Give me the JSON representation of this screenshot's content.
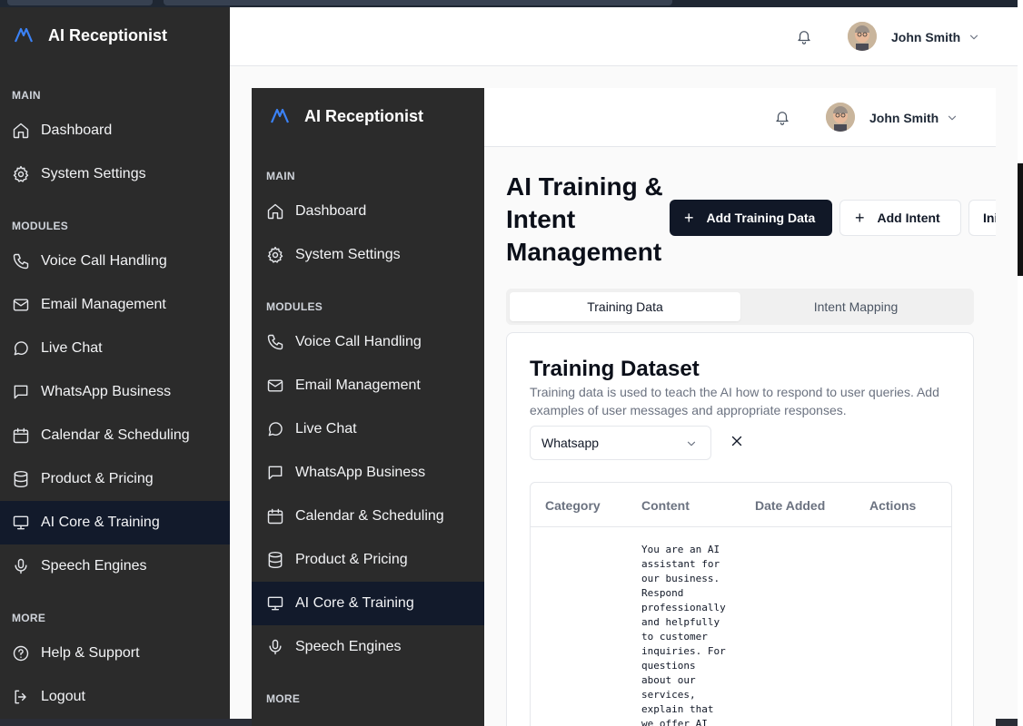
{
  "app": {
    "brand_name": "AI Receptionist"
  },
  "sidebar": {
    "sections": {
      "main": "MAIN",
      "modules": "MODULES",
      "more": "MORE"
    },
    "items": [
      {
        "label": "Dashboard",
        "icon": "home-icon"
      },
      {
        "label": "System Settings",
        "icon": "gear-icon"
      },
      {
        "label": "Voice Call Handling",
        "icon": "phone-icon"
      },
      {
        "label": "Email Management",
        "icon": "mail-icon"
      },
      {
        "label": "Live Chat",
        "icon": "chat-bubble-icon"
      },
      {
        "label": "WhatsApp Business",
        "icon": "message-square-icon"
      },
      {
        "label": "Calendar & Scheduling",
        "icon": "calendar-icon"
      },
      {
        "label": "Product & Pricing",
        "icon": "database-icon"
      },
      {
        "label": "AI Core & Training",
        "icon": "monitor-icon",
        "active": true
      },
      {
        "label": "Speech Engines",
        "icon": "microphone-icon"
      },
      {
        "label": "Help & Support",
        "icon": "help-circle-icon"
      },
      {
        "label": "Logout",
        "icon": "logout-icon"
      }
    ]
  },
  "header": {
    "user_name": "John Smith"
  },
  "main": {
    "title": "AI Training & Intent Management",
    "buttons": {
      "add_training": "Add Training Data",
      "add_intent": "Add Intent",
      "partial": "Ini"
    },
    "tabs": [
      {
        "label": "Training Data",
        "active": true
      },
      {
        "label": "Intent Mapping",
        "active": false
      }
    ],
    "card": {
      "title": "Training Dataset",
      "description": "Training data is used to teach the AI how to respond to user queries. Add examples of user messages and appropriate responses.",
      "filter_value": "Whatsapp",
      "table": {
        "headers": [
          "Category",
          "Content",
          "Date Added",
          "Actions"
        ],
        "row_content": "You are an AI\nassistant for\nour business.\nRespond\nprofessionally\nand helpfully\nto customer\ninquiries. For\nquestions\nabout our\nservices,\nexplain that\nwe offer AI"
      }
    }
  },
  "colors": {
    "sidebar_bg": "#2b2b2b",
    "active_item_bg": "#121a2b",
    "primary_button": "#111827"
  }
}
